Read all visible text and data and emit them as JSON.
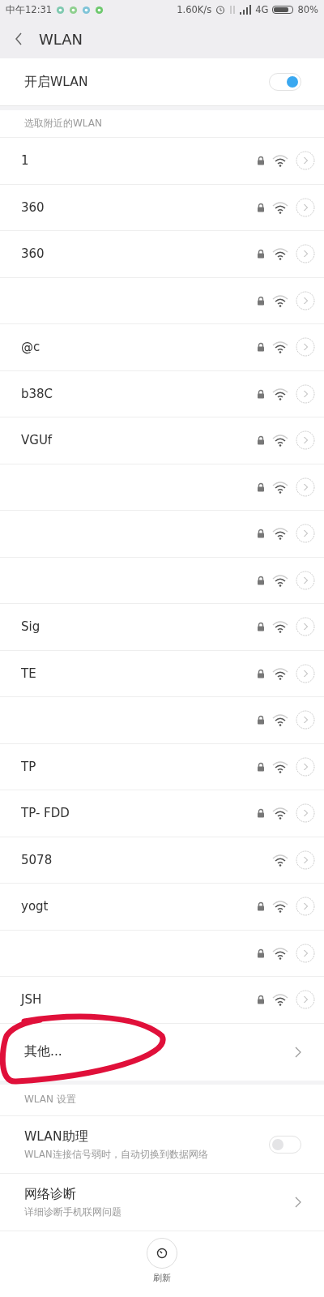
{
  "status_bar": {
    "time": "中午12:31",
    "speed": "1.60K/s",
    "network": "4G",
    "battery": "80%"
  },
  "header": {
    "title": "WLAN"
  },
  "wlan_switch": {
    "label": "开启WLAN",
    "on": true
  },
  "nearby": {
    "heading": "选取附近的WLAN",
    "networks": [
      {
        "name": "1",
        "locked": true
      },
      {
        "name": "360",
        "locked": true
      },
      {
        "name": "360",
        "locked": true
      },
      {
        "locked": true
      },
      {
        "name": "@c",
        "locked": true
      },
      {
        "name": "b38C",
        "locked": true
      },
      {
        "name": "VGUf",
        "locked": true
      },
      {
        "locked": true
      },
      {
        "locked": true
      },
      {
        "locked": true
      },
      {
        "name": "Sig",
        "locked": true
      },
      {
        "name": "TE",
        "locked": true
      },
      {
        "locked": true
      },
      {
        "name": "TP",
        "locked": true
      },
      {
        "name": "TP- FDD",
        "locked": true
      },
      {
        "name": "5078",
        "locked": false
      },
      {
        "name": "yogt",
        "locked": true
      },
      {
        "locked": true
      },
      {
        "name": "JSH",
        "locked": true
      }
    ],
    "other": "其他..."
  },
  "settings": {
    "heading": "WLAN 设置",
    "items": [
      {
        "kind": "toggle",
        "title": "WLAN助理",
        "subtitle": "WLAN连接信号弱时，自动切换到数据网络",
        "on": false
      },
      {
        "kind": "link",
        "title": "网络诊断",
        "subtitle": "详细诊断手机联网问题"
      }
    ]
  },
  "bottom": {
    "refresh": "刷新"
  }
}
